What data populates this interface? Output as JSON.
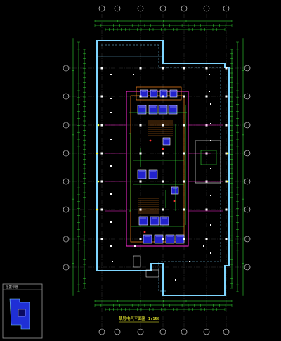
{
  "drawing": {
    "title": "某层电气平面图 1:150",
    "keyplan_title": "位置示意",
    "grid_col_marks": [
      "",
      "",
      "",
      "",
      "",
      "",
      ""
    ],
    "grid_row_marks": [
      "",
      "",
      "",
      "",
      "",
      "",
      "",
      ""
    ],
    "colors": {
      "background": "#000000",
      "gridline": "#3a3a3a",
      "wall": "#7fd6ff",
      "dimension": "#3cff3c",
      "magenta": "#ff2bd6",
      "orange": "#ff8a1f",
      "room_fill": "#2222cc",
      "white": "#ffffff",
      "yellow": "#ffff33",
      "red": "#ff3030"
    }
  }
}
